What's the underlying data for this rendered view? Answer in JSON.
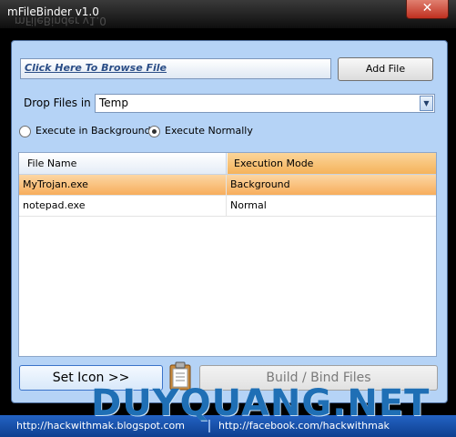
{
  "window": {
    "title": "mFileBinder v1.0",
    "close_glyph": "✕"
  },
  "browse": {
    "link_text": "Click Here To Browse File",
    "add_button": "Add File"
  },
  "drop": {
    "label": "Drop Files in",
    "selected": "Temp"
  },
  "execute": {
    "options": [
      {
        "label": "Execute in Background",
        "checked": false
      },
      {
        "label": "Execute Normally",
        "checked": true
      }
    ]
  },
  "grid": {
    "columns": [
      "File Name",
      "Execution Mode"
    ],
    "rows": [
      {
        "name": "MyTrojan.exe",
        "mode": "Background",
        "selected": true
      },
      {
        "name": "notepad.exe",
        "mode": "Normal",
        "selected": false
      }
    ]
  },
  "actions": {
    "set_icon": "Set Icon >>",
    "build": "Build / Bind Files"
  },
  "icons": {
    "clipboard": "clipboard-icon"
  },
  "status": {
    "left_link": "http://hackwithmak.blogspot.com",
    "right_link": "http://facebook.com/hackwithmak"
  },
  "watermark": "DUYQUANG.NET",
  "colors": {
    "accent": "#f7ad5c",
    "panel": "#b5d3f6",
    "statusbar": "#1a52a8"
  }
}
